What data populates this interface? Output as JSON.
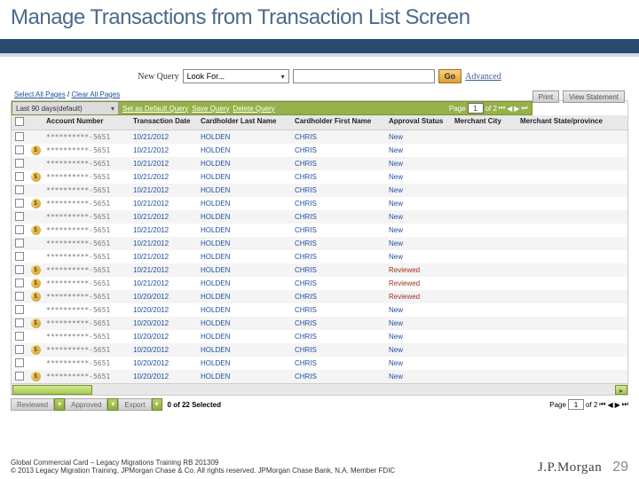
{
  "title": "Manage Transactions from Transaction List Screen",
  "query": {
    "new_label": "New Query",
    "look_for": "Look For...",
    "go": "Go",
    "advanced": "Advanced"
  },
  "topLinks": {
    "selectAll": "Select All Pages",
    "clearAll": "Clear All Pages",
    "print": "Print",
    "viewStmt": "View Statement"
  },
  "greenBar": {
    "range": "Last 90 days(default)",
    "setDefault": "Set as Default Query",
    "saveQuery": "Save Query",
    "deleteQuery": "Delete Query",
    "pageLabel": "Page",
    "pageNum": "1",
    "ofText": "of 2"
  },
  "columns": [
    "",
    "",
    "Account Number",
    "Transaction Date",
    "Cardholder Last Name",
    "Cardholder First Name",
    "Approval Status",
    "Merchant City",
    "Merchant State/province"
  ],
  "rows": [
    {
      "coin": false,
      "acct": "**********-5651",
      "date": "10/21/2012",
      "last": "HOLDEN",
      "first": "CHRIS",
      "status": "New"
    },
    {
      "coin": true,
      "acct": "**********-5651",
      "date": "10/21/2012",
      "last": "HOLDEN",
      "first": "CHRIS",
      "status": "New"
    },
    {
      "coin": false,
      "acct": "**********-5651",
      "date": "10/21/2012",
      "last": "HOLDEN",
      "first": "CHRIS",
      "status": "New"
    },
    {
      "coin": true,
      "acct": "**********-5651",
      "date": "10/21/2012",
      "last": "HOLDEN",
      "first": "CHRIS",
      "status": "New"
    },
    {
      "coin": false,
      "acct": "**********-5651",
      "date": "10/21/2012",
      "last": "HOLDEN",
      "first": "CHRIS",
      "status": "New"
    },
    {
      "coin": true,
      "acct": "**********-5651",
      "date": "10/21/2012",
      "last": "HOLDEN",
      "first": "CHRIS",
      "status": "New"
    },
    {
      "coin": false,
      "acct": "**********-5651",
      "date": "10/21/2012",
      "last": "HOLDEN",
      "first": "CHRIS",
      "status": "New"
    },
    {
      "coin": true,
      "acct": "**********-5651",
      "date": "10/21/2012",
      "last": "HOLDEN",
      "first": "CHRIS",
      "status": "New"
    },
    {
      "coin": false,
      "acct": "**********-5651",
      "date": "10/21/2012",
      "last": "HOLDEN",
      "first": "CHRIS",
      "status": "New"
    },
    {
      "coin": false,
      "acct": "**********-5651",
      "date": "10/21/2012",
      "last": "HOLDEN",
      "first": "CHRIS",
      "status": "New"
    },
    {
      "coin": true,
      "acct": "**********-5651",
      "date": "10/21/2012",
      "last": "HOLDEN",
      "first": "CHRIS",
      "status": "Reviewed"
    },
    {
      "coin": true,
      "acct": "**********-5651",
      "date": "10/21/2012",
      "last": "HOLDEN",
      "first": "CHRIS",
      "status": "Reviewed"
    },
    {
      "coin": true,
      "acct": "**********-5651",
      "date": "10/20/2012",
      "last": "HOLDEN",
      "first": "CHRIS",
      "status": "Reviewed"
    },
    {
      "coin": false,
      "acct": "**********-5651",
      "date": "10/20/2012",
      "last": "HOLDEN",
      "first": "CHRIS",
      "status": "New"
    },
    {
      "coin": true,
      "acct": "**********-5651",
      "date": "10/20/2012",
      "last": "HOLDEN",
      "first": "CHRIS",
      "status": "New"
    },
    {
      "coin": false,
      "acct": "**********-5651",
      "date": "10/20/2012",
      "last": "HOLDEN",
      "first": "CHRIS",
      "status": "New"
    },
    {
      "coin": true,
      "acct": "**********-5651",
      "date": "10/20/2012",
      "last": "HOLDEN",
      "first": "CHRIS",
      "status": "New"
    },
    {
      "coin": false,
      "acct": "**********-5651",
      "date": "10/20/2012",
      "last": "HOLDEN",
      "first": "CHRIS",
      "status": "New"
    },
    {
      "coin": true,
      "acct": "**********-5651",
      "date": "10/20/2012",
      "last": "HOLDEN",
      "first": "CHRIS",
      "status": "New"
    }
  ],
  "footerBtns": {
    "reviewed": "Reviewed",
    "approved": "Approved",
    "export": "Export",
    "selected": "0 of 22 Selected",
    "pageLabel": "Page",
    "pageNum": "1",
    "ofText": "of 2"
  },
  "pageFooter": {
    "line1": "Global Commercial Card – Legacy Migrations Training RB 201309",
    "line2": "© 2013 Legacy Migration Training, JPMorgan Chase & Co. All rights reserved. JPMorgan Chase Bank, N.A. Member FDIC",
    "logo": "J.P.Morgan",
    "pageNum": "29"
  }
}
